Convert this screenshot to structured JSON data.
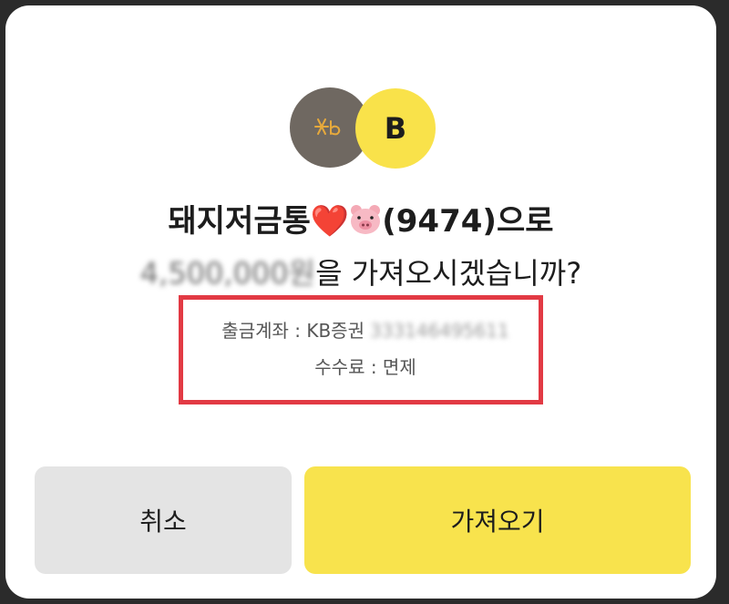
{
  "dialog": {
    "logos": {
      "kb_icon": "kb-logo",
      "b_label": "B",
      "kb_color": "#6f6861",
      "b_color": "#f9e24a"
    },
    "title": {
      "account_name": "돼지저금통",
      "heart": "❤️",
      "pig_icon": "pig-face-icon",
      "account_suffix": "(9474)으로"
    },
    "question": {
      "amount": "4,500,000원",
      "text": "을 가져오시겠습니까?"
    },
    "details": {
      "withdraw_label": "출금계좌 : KB증권",
      "withdraw_account": "333146495611",
      "fee_label": "수수료 : 면제"
    },
    "buttons": {
      "cancel": "취소",
      "confirm": "가져오기"
    },
    "colors": {
      "highlight_box": "#e23a44",
      "confirm_button": "#f8e34d",
      "cancel_button": "#e4e4e4"
    }
  }
}
